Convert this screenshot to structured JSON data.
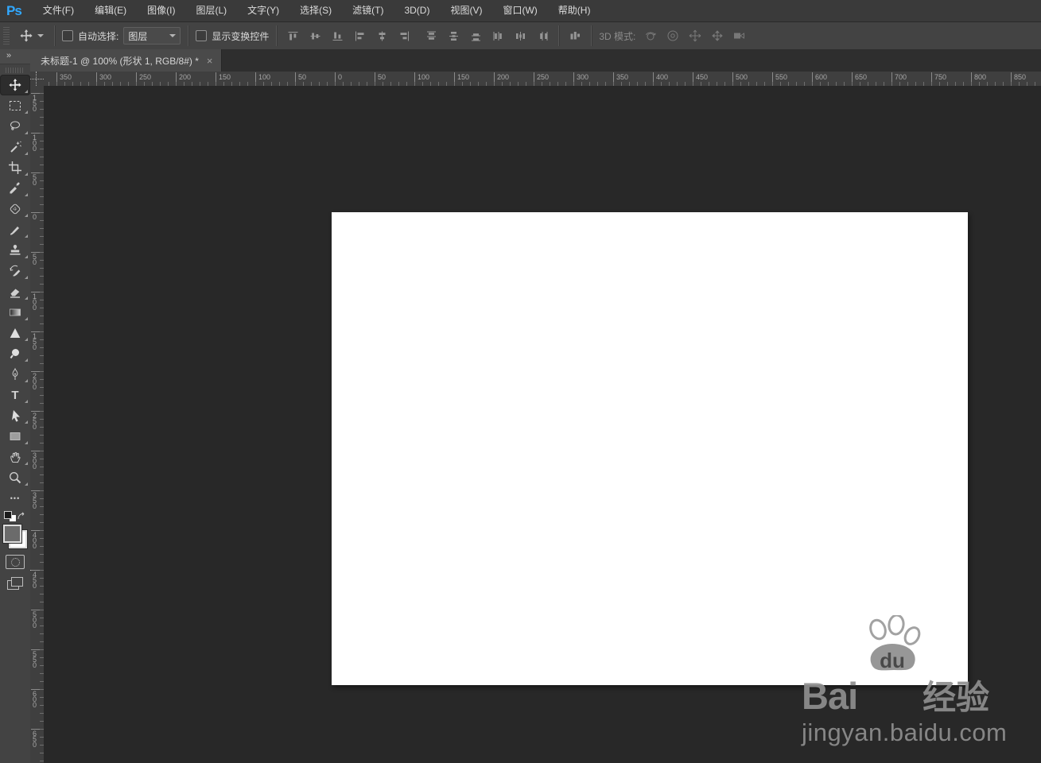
{
  "app": {
    "logo_text": "Ps"
  },
  "menu_bar": {
    "items": [
      "文件(F)",
      "编辑(E)",
      "图像(I)",
      "图层(L)",
      "文字(Y)",
      "选择(S)",
      "滤镜(T)",
      "3D(D)",
      "视图(V)",
      "窗口(W)",
      "帮助(H)"
    ]
  },
  "options_bar": {
    "auto_select_label": "自动选择:",
    "auto_select_checked": false,
    "auto_select_value": "图层",
    "show_transform_label": "显示变换控件",
    "show_transform_checked": false,
    "mode_3d_label": "3D 模式:"
  },
  "document_tab": {
    "title": "未标题-1 @ 100% (形状 1, RGB/8#) *",
    "close_glyph": "×"
  },
  "rulers": {
    "horizontal_labels": [
      "350",
      "300",
      "250",
      "200",
      "150",
      "100",
      "50",
      "0",
      "50",
      "100",
      "150",
      "200",
      "250",
      "300",
      "350",
      "400",
      "450",
      "500",
      "550",
      "600",
      "650",
      "700",
      "750",
      "800",
      "850"
    ],
    "vertical_labels": [
      "150",
      "100",
      "50",
      "0",
      "50",
      "100",
      "150",
      "200",
      "250",
      "300",
      "350",
      "400",
      "450",
      "500",
      "550",
      "600",
      "650"
    ]
  },
  "toolbar": {
    "collapse_glyph": "»",
    "tools": [
      "move",
      "rectangular-marquee",
      "lasso",
      "quick-selection",
      "crop",
      "eyedropper",
      "spot-healing-brush",
      "brush",
      "clone-stamp",
      "history-brush",
      "eraser",
      "gradient",
      "sharpen",
      "dodge",
      "pen",
      "horizontal-type",
      "path-selection",
      "rectangle-shape",
      "hand",
      "zoom"
    ],
    "selected_tool": "move",
    "type_tool_glyph": "T",
    "more_tools_glyph": "•••",
    "foreground_color": "#6b6b6b",
    "background_color": "#ffffff"
  },
  "watermark": {
    "brand_bai": "Bai",
    "brand_du": "du",
    "brand_cn": "经验",
    "url": "jingyan.baidu.com"
  },
  "colors": {
    "ps_logo_blue": "#31a8ff",
    "pasteboard": "#282828",
    "canvas": "#ffffff",
    "panel_gray": "#434343",
    "ruler_bg": "#3f3f3f"
  }
}
